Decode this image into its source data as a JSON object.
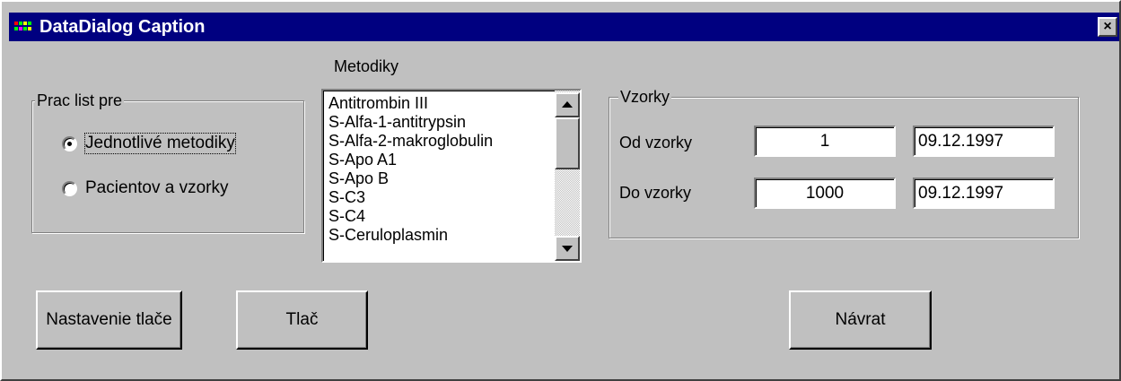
{
  "window": {
    "title": "DataDialog Caption",
    "close_glyph": "×",
    "app_icon": "app-grid-icon"
  },
  "metodiky": {
    "label": "Metodiky",
    "items": [
      "Antitrombin III",
      "S-Alfa-1-antitrypsin",
      "S-Alfa-2-makroglobulin",
      "S-Apo A1",
      "S-Apo B",
      "S-C3",
      "S-C4",
      "S-Ceruloplasmin"
    ]
  },
  "prac_list": {
    "legend": "Prac list pre",
    "options": [
      {
        "label": "Jednotlivé metodiky",
        "selected": true
      },
      {
        "label": "Pacientov a vzorky",
        "selected": false
      }
    ]
  },
  "vzorky": {
    "legend": "Vzorky",
    "od_label": "Od vzorky",
    "od_value": "1",
    "od_date": "09.12.1997",
    "do_label": "Do vzorky",
    "do_value": "1000",
    "do_date": "09.12.1997"
  },
  "buttons": {
    "nastavenie": "Nastavenie tlače",
    "tlac": "Tlač",
    "navrat": "Návrat"
  }
}
